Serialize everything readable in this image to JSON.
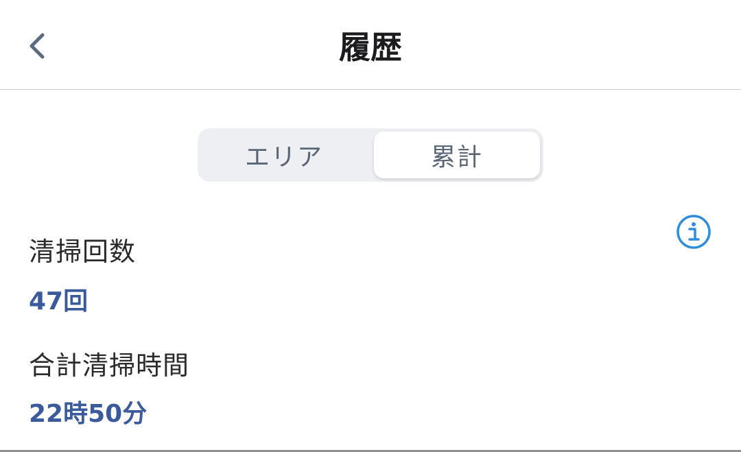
{
  "header": {
    "title": "履歴",
    "back_icon": "chevron-left-icon"
  },
  "tabs": [
    {
      "label": "エリア",
      "active": false
    },
    {
      "label": "累計",
      "active": true
    }
  ],
  "stats": {
    "cleaning_count_label": "清掃回数",
    "cleaning_count_value": "47回",
    "total_time_label": "合計清掃時間",
    "total_time_value": "22時50分"
  },
  "info_icon": "info-icon",
  "colors": {
    "accent": "#3a5a9b",
    "info_blue": "#2f8ddc",
    "segment_bg": "#eeeff2"
  }
}
